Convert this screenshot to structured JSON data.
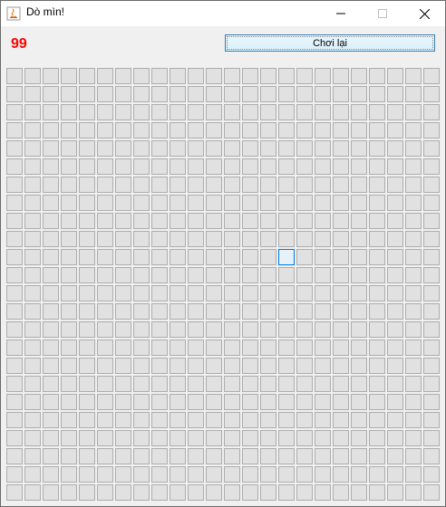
{
  "window": {
    "title": "Dò mìn!",
    "controls": {
      "minimize_icon": "minimize-icon",
      "maximize_icon": "maximize-icon",
      "close_icon": "close-icon"
    }
  },
  "toolbar": {
    "mine_counter": "99",
    "replay_label": "Chơi lại"
  },
  "board": {
    "rows": 24,
    "columns": 24,
    "focused_cell": {
      "row": 10,
      "col": 15
    },
    "colors": {
      "cell_bg": "#e1e1e1",
      "cell_border": "#adadad",
      "focus_border": "#0078d7",
      "counter": "#ff0000"
    }
  }
}
